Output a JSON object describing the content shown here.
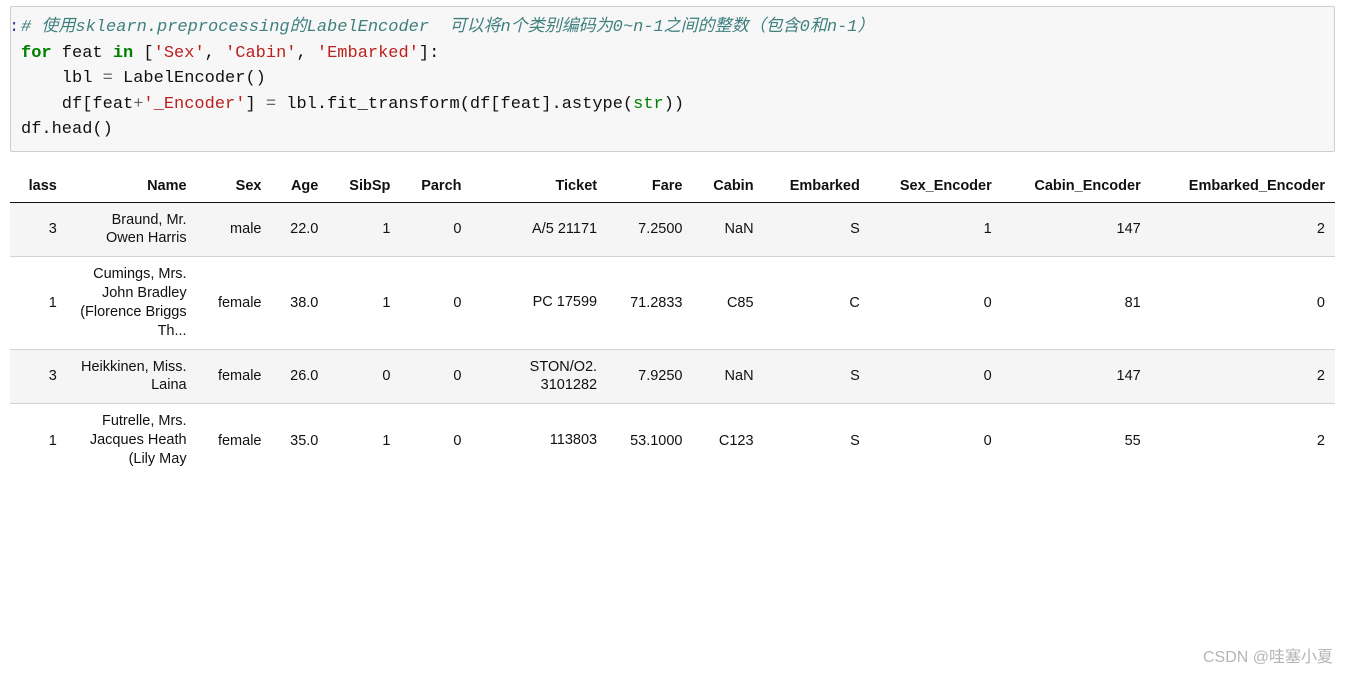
{
  "code": {
    "line1_comment": "# 使用sklearn.preprocessing的LabelEncoder  可以将n个类别编码为0~n-1之间的整数（包含0和n-1）",
    "line2_kw_for": "for",
    "line2_var": " feat ",
    "line2_kw_in": "in",
    "line2_list_open": " [",
    "line2_s1": "'Sex'",
    "line2_c1": ", ",
    "line2_s2": "'Cabin'",
    "line2_c2": ", ",
    "line2_s3": "'Embarked'",
    "line2_list_close": "]:",
    "line3": "    lbl ",
    "line3_eq": "=",
    "line3_rest": " LabelEncoder()",
    "line4_a": "    df[feat",
    "line4_plus": "+",
    "line4_s": "'_Encoder'",
    "line4_b": "] ",
    "line4_eq": "=",
    "line4_c": " lbl.fit_transform(df[feat].astype(",
    "line4_builtin": "str",
    "line4_d": "))",
    "line5": "df.head()"
  },
  "chart_data": {
    "type": "table",
    "columns": [
      "lass",
      "Name",
      "Sex",
      "Age",
      "SibSp",
      "Parch",
      "Ticket",
      "Fare",
      "Cabin",
      "Embarked",
      "Sex_Encoder",
      "Cabin_Encoder",
      "Embarked_Encoder"
    ],
    "rows": [
      {
        "lass": "3",
        "Name": "Braund, Mr. Owen Harris",
        "Sex": "male",
        "Age": "22.0",
        "SibSp": "1",
        "Parch": "0",
        "Ticket": "A/5 21171",
        "Fare": "7.2500",
        "Cabin": "NaN",
        "Embarked": "S",
        "Sex_Encoder": "1",
        "Cabin_Encoder": "147",
        "Embarked_Encoder": "2"
      },
      {
        "lass": "1",
        "Name": "Cumings, Mrs. John Bradley (Florence Briggs Th...",
        "Sex": "female",
        "Age": "38.0",
        "SibSp": "1",
        "Parch": "0",
        "Ticket": "PC 17599",
        "Fare": "71.2833",
        "Cabin": "C85",
        "Embarked": "C",
        "Sex_Encoder": "0",
        "Cabin_Encoder": "81",
        "Embarked_Encoder": "0"
      },
      {
        "lass": "3",
        "Name": "Heikkinen, Miss. Laina",
        "Sex": "female",
        "Age": "26.0",
        "SibSp": "0",
        "Parch": "0",
        "Ticket": "STON/O2. 3101282",
        "Fare": "7.9250",
        "Cabin": "NaN",
        "Embarked": "S",
        "Sex_Encoder": "0",
        "Cabin_Encoder": "147",
        "Embarked_Encoder": "2"
      },
      {
        "lass": "1",
        "Name": "Futrelle, Mrs. Jacques Heath (Lily May",
        "Sex": "female",
        "Age": "35.0",
        "SibSp": "1",
        "Parch": "0",
        "Ticket": "113803",
        "Fare": "53.1000",
        "Cabin": "C123",
        "Embarked": "S",
        "Sex_Encoder": "0",
        "Cabin_Encoder": "55",
        "Embarked_Encoder": "2"
      }
    ]
  },
  "watermark": "CSDN @哇塞小夏"
}
